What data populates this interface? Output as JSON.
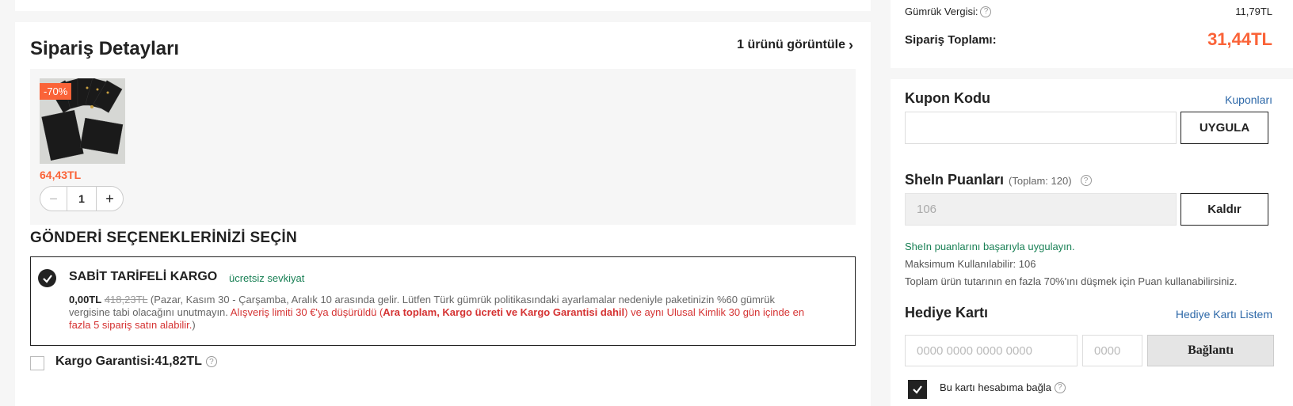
{
  "order": {
    "title": "Sipariş Detayları",
    "view_products": "1 ürünü görüntüle",
    "product": {
      "discount_badge": "-70%",
      "price": "64,43TL",
      "quantity": "1",
      "minus": "−",
      "plus": "+"
    }
  },
  "shipping": {
    "heading": "GÖNDERİ SEÇENEKLERİNİZİ SEÇİN",
    "option": {
      "name": "SABİT TARİFELİ KARGO",
      "free_tag": "ücretsiz sevkiyat",
      "price_now": "0,00TL",
      "price_old": "418,23TL",
      "desc_gray": " (Pazar, Kasım 30 - Çarşamba, Aralık 10 arasında gelir. Lütfen Türk gümrük politikasındaki ayarlamalar nedeniyle paketinizin %60 gümrük vergisine tabi olacağını unutmayın. ",
      "desc_red1": "Alışveriş limiti 30 €'ya düşürüldü (",
      "desc_red_bold": "Ara toplam, Kargo ücreti ve Kargo Garantisi dahil",
      "desc_red2": ") ve aynı Ulusal Kimlik 30 gün içinde en fazla 5 sipariş satın alabilir.",
      "desc_end": ")"
    },
    "guarantee_label": "Kargo Garantisi:41,82TL"
  },
  "summary": {
    "customs_label": "Gümrük Vergisi:",
    "customs_value": "11,79TL",
    "total_label": "Sipariş Toplamı:",
    "total_value": "31,44TL"
  },
  "coupon": {
    "title": "Kupon Kodu",
    "link": "Kuponları",
    "input_value": "",
    "apply_button": "UYGULA"
  },
  "points": {
    "title": "SheIn Puanları",
    "total_info": "(Toplam: 120)",
    "input_value": "106",
    "remove_button": "Kaldır",
    "success_msg": "SheIn puanlarını başarıyla uygulayın.",
    "max_usable": "Maksimum Kullanılabilir: 106",
    "note": "Toplam ürün tutarının en fazla 70%'ını düşmek için Puan kullanabilirsiniz."
  },
  "gift_card": {
    "title": "Hediye Kartı",
    "link": "Hediye Kartı Listem",
    "card_placeholder": "0000 0000 0000 0000",
    "pin_placeholder": "0000",
    "connect_button": "Bağlantı",
    "bind_label": "Bu kartı hesabıma bağla"
  },
  "colors": {
    "accent_orange": "#fa6338",
    "success_green": "#198055",
    "warning_red": "#d53333",
    "link_blue": "#2d68a8"
  },
  "icons": [
    "chevron-right-icon",
    "check-icon",
    "help-icon"
  ]
}
